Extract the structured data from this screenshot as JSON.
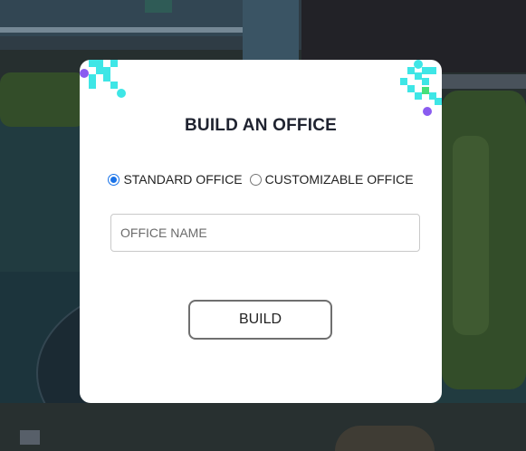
{
  "modal": {
    "title": "BUILD AN OFFICE",
    "options": [
      {
        "label": "STANDARD OFFICE",
        "checked": true
      },
      {
        "label": "CUSTOMIZABLE OFFICE",
        "checked": false
      }
    ],
    "office_name": {
      "value": "",
      "placeholder": "OFFICE NAME"
    },
    "build_label": "BUILD"
  },
  "colors": {
    "accent_cyan": "#3ee6e6",
    "accent_green": "#45e07a",
    "accent_purple": "#8a5cf0",
    "radio_checked": "#1a73e8",
    "modal_bg": "#ffffff"
  },
  "icons": [
    "pixel-decoration-icon"
  ]
}
